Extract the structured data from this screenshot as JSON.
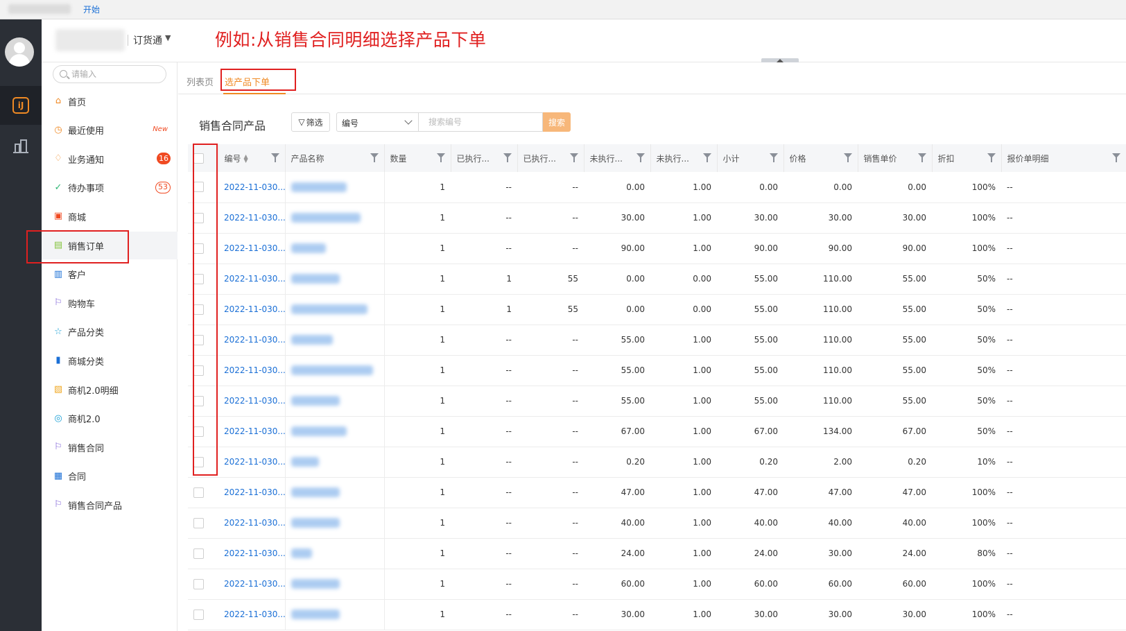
{
  "topbar": {
    "start_link": "开始"
  },
  "header": {
    "app_name": "订货通",
    "app_caret": "▼",
    "annotation": "例如:从销售合同明细选择产品下单"
  },
  "sidebar": {
    "search_placeholder": "请输入",
    "items": [
      {
        "label": "首页",
        "icon": "home-icon",
        "color": "#f08a24"
      },
      {
        "label": "最近使用",
        "icon": "clock-icon",
        "color": "#f08a24",
        "badge_new": "New"
      },
      {
        "label": "业务通知",
        "icon": "bell-icon",
        "color": "#f08a24",
        "badge": "16"
      },
      {
        "label": "待办事项",
        "icon": "check-circle-icon",
        "color": "#2bb673",
        "badge_outline": "53"
      },
      {
        "label": "商城",
        "icon": "shop-bag-icon",
        "color": "#f04a22"
      },
      {
        "label": "销售订单",
        "icon": "order-clipboard-icon",
        "color": "#86c440"
      },
      {
        "label": "客户",
        "icon": "customer-book-icon",
        "color": "#1a6fd6"
      },
      {
        "label": "购物车",
        "icon": "flag-icon",
        "color": "#7a5cd6"
      },
      {
        "label": "产品分类",
        "icon": "category-star-icon",
        "color": "#1aa0d6"
      },
      {
        "label": "商城分类",
        "icon": "bar-chart-icon",
        "color": "#1a6fd6"
      },
      {
        "label": "商机2.0明细",
        "icon": "detail-doc-icon",
        "color": "#f0a824"
      },
      {
        "label": "商机2.0",
        "icon": "target-icon",
        "color": "#1aa0d6"
      },
      {
        "label": "销售合同",
        "icon": "flag-icon",
        "color": "#7a5cd6"
      },
      {
        "label": "合同",
        "icon": "contract-doc-icon",
        "color": "#1a6fd6"
      },
      {
        "label": "销售合同产品",
        "icon": "flag-icon",
        "color": "#7a5cd6"
      }
    ]
  },
  "tabs": [
    {
      "label": "列表页"
    },
    {
      "label": "选产品下单"
    }
  ],
  "toolbar": {
    "title": "销售合同产品",
    "filter_label": "筛选",
    "field_value": "编号",
    "search_placeholder": "搜索编号",
    "search_label": "搜索"
  },
  "table": {
    "columns": [
      "编号",
      "产品名称",
      "数量",
      "已执行...",
      "已执行...",
      "未执行...",
      "未执行...",
      "小计",
      "价格",
      "销售单价",
      "折扣",
      "报价单明细"
    ],
    "rows": [
      {
        "code": "2022-11-030...",
        "qty": "1",
        "e1": "--",
        "e2": "--",
        "u1": "0.00",
        "u2": "1.00",
        "sub": "0.00",
        "price": "0.00",
        "unit": "0.00",
        "disc": "100%",
        "quote": "--"
      },
      {
        "code": "2022-11-030...",
        "qty": "1",
        "e1": "--",
        "e2": "--",
        "u1": "30.00",
        "u2": "1.00",
        "sub": "30.00",
        "price": "30.00",
        "unit": "30.00",
        "disc": "100%",
        "quote": "--"
      },
      {
        "code": "2022-11-030...",
        "qty": "1",
        "e1": "--",
        "e2": "--",
        "u1": "90.00",
        "u2": "1.00",
        "sub": "90.00",
        "price": "90.00",
        "unit": "90.00",
        "disc": "100%",
        "quote": "--"
      },
      {
        "code": "2022-11-030...",
        "qty": "1",
        "e1": "1",
        "e2": "55",
        "u1": "0.00",
        "u2": "0.00",
        "sub": "55.00",
        "price": "110.00",
        "unit": "55.00",
        "disc": "50%",
        "quote": "--"
      },
      {
        "code": "2022-11-030...",
        "qty": "1",
        "e1": "1",
        "e2": "55",
        "u1": "0.00",
        "u2": "0.00",
        "sub": "55.00",
        "price": "110.00",
        "unit": "55.00",
        "disc": "50%",
        "quote": "--"
      },
      {
        "code": "2022-11-030...",
        "qty": "1",
        "e1": "--",
        "e2": "--",
        "u1": "55.00",
        "u2": "1.00",
        "sub": "55.00",
        "price": "110.00",
        "unit": "55.00",
        "disc": "50%",
        "quote": "--"
      },
      {
        "code": "2022-11-030...",
        "qty": "1",
        "e1": "--",
        "e2": "--",
        "u1": "55.00",
        "u2": "1.00",
        "sub": "55.00",
        "price": "110.00",
        "unit": "55.00",
        "disc": "50%",
        "quote": "--"
      },
      {
        "code": "2022-11-030...",
        "qty": "1",
        "e1": "--",
        "e2": "--",
        "u1": "55.00",
        "u2": "1.00",
        "sub": "55.00",
        "price": "110.00",
        "unit": "55.00",
        "disc": "50%",
        "quote": "--"
      },
      {
        "code": "2022-11-030...",
        "qty": "1",
        "e1": "--",
        "e2": "--",
        "u1": "67.00",
        "u2": "1.00",
        "sub": "67.00",
        "price": "134.00",
        "unit": "67.00",
        "disc": "50%",
        "quote": "--"
      },
      {
        "code": "2022-11-030...",
        "qty": "1",
        "e1": "--",
        "e2": "--",
        "u1": "0.20",
        "u2": "1.00",
        "sub": "0.20",
        "price": "2.00",
        "unit": "0.20",
        "disc": "10%",
        "quote": "--"
      },
      {
        "code": "2022-11-030...",
        "qty": "1",
        "e1": "--",
        "e2": "--",
        "u1": "47.00",
        "u2": "1.00",
        "sub": "47.00",
        "price": "47.00",
        "unit": "47.00",
        "disc": "100%",
        "quote": "--"
      },
      {
        "code": "2022-11-030...",
        "qty": "1",
        "e1": "--",
        "e2": "--",
        "u1": "40.00",
        "u2": "1.00",
        "sub": "40.00",
        "price": "40.00",
        "unit": "40.00",
        "disc": "100%",
        "quote": "--"
      },
      {
        "code": "2022-11-030...",
        "qty": "1",
        "e1": "--",
        "e2": "--",
        "u1": "24.00",
        "u2": "1.00",
        "sub": "24.00",
        "price": "30.00",
        "unit": "24.00",
        "disc": "80%",
        "quote": "--"
      },
      {
        "code": "2022-11-030...",
        "qty": "1",
        "e1": "--",
        "e2": "--",
        "u1": "60.00",
        "u2": "1.00",
        "sub": "60.00",
        "price": "60.00",
        "unit": "60.00",
        "disc": "100%",
        "quote": "--"
      },
      {
        "code": "2022-11-030...",
        "qty": "1",
        "e1": "--",
        "e2": "--",
        "u1": "30.00",
        "u2": "1.00",
        "sub": "30.00",
        "price": "30.00",
        "unit": "30.00",
        "disc": "100%",
        "quote": "--"
      }
    ]
  }
}
